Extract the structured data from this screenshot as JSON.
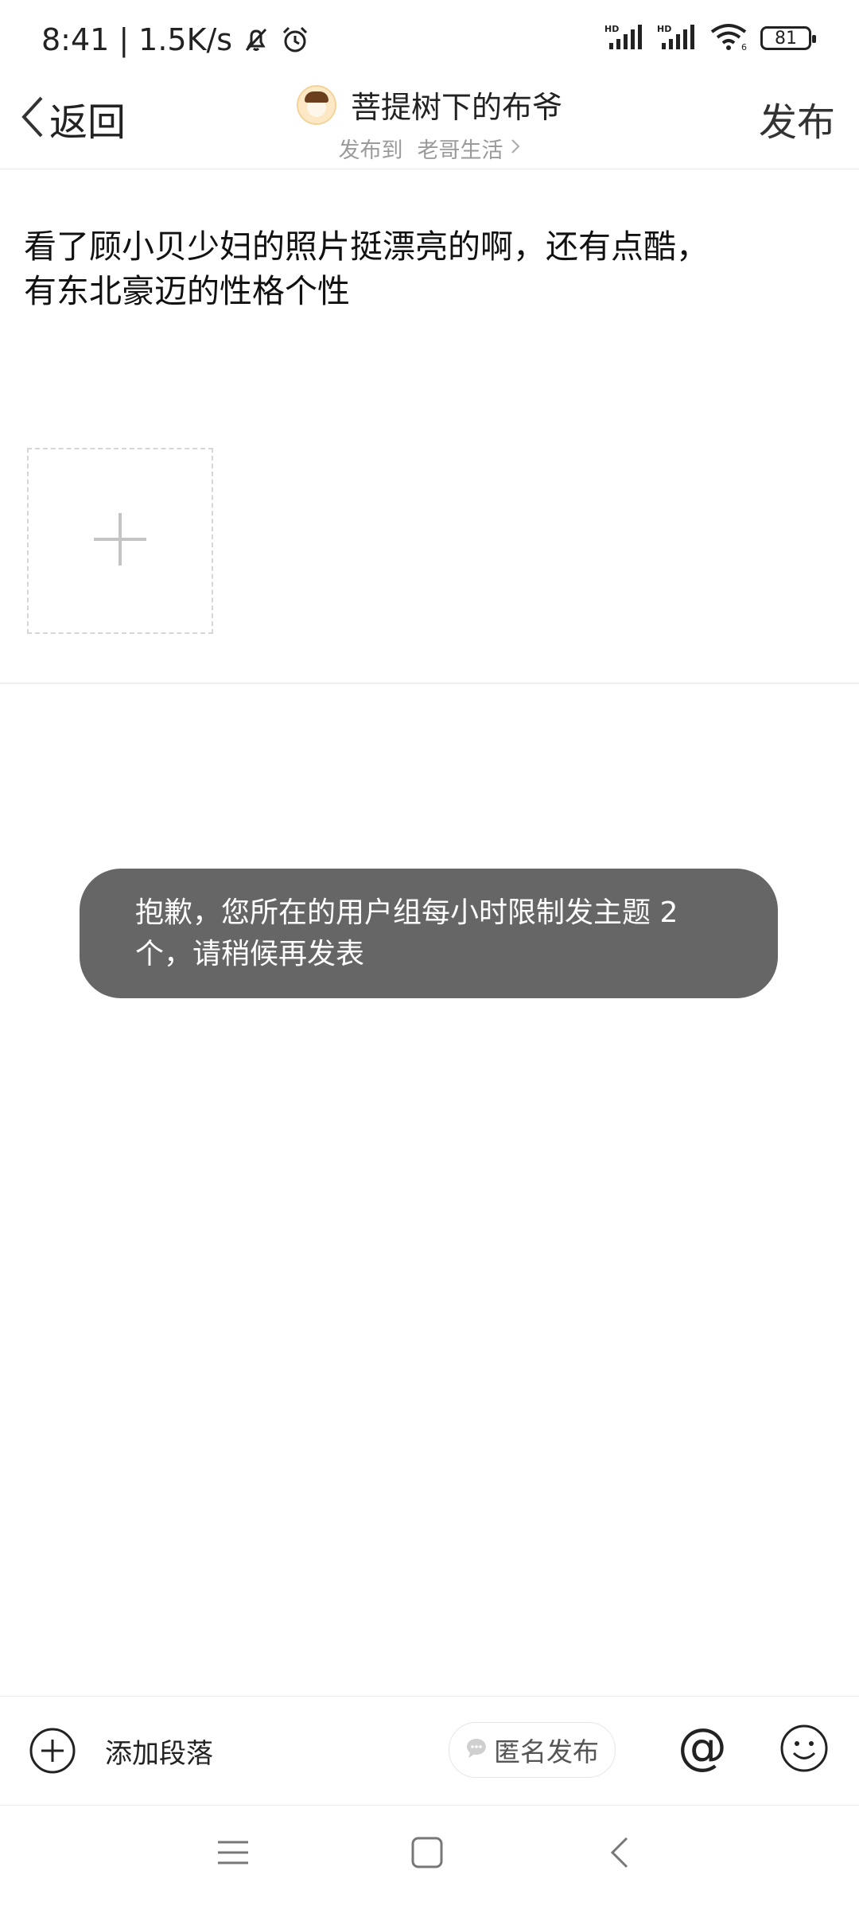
{
  "status_bar": {
    "time": "8:41",
    "separator": "|",
    "net_speed": "1.5K/s",
    "signal1_label": "HD",
    "signal2_label": "HD",
    "wifi_label": "6",
    "battery": "81"
  },
  "header": {
    "back_label": "返回",
    "username": "菩提树下的布爷",
    "post_to_label": "发布到",
    "forum_name": "老哥生活",
    "publish_label": "发布"
  },
  "content": {
    "text_line1": "看了顾小贝少妇的照片挺漂亮的啊，还有点酷，",
    "text_line2": "有东北豪迈的性格个性"
  },
  "toast": {
    "line1": "抱歉，您所在的用户组每小时限制发主题 2",
    "line2": "个，请稍候再发表"
  },
  "toolbar": {
    "add_paragraph": "添加段落",
    "anonymous": "匿名发布",
    "at_symbol": "@"
  },
  "icons": [
    "dnd-bell-icon",
    "alarm-icon",
    "signal-icon",
    "wifi-icon",
    "battery-icon",
    "back-chevron-icon",
    "avatar",
    "chevron-right-icon",
    "plus-icon",
    "circle-plus-icon",
    "chat-bubble-icon",
    "smiley-icon",
    "menu-icon",
    "home-square-icon",
    "back-nav-icon"
  ]
}
